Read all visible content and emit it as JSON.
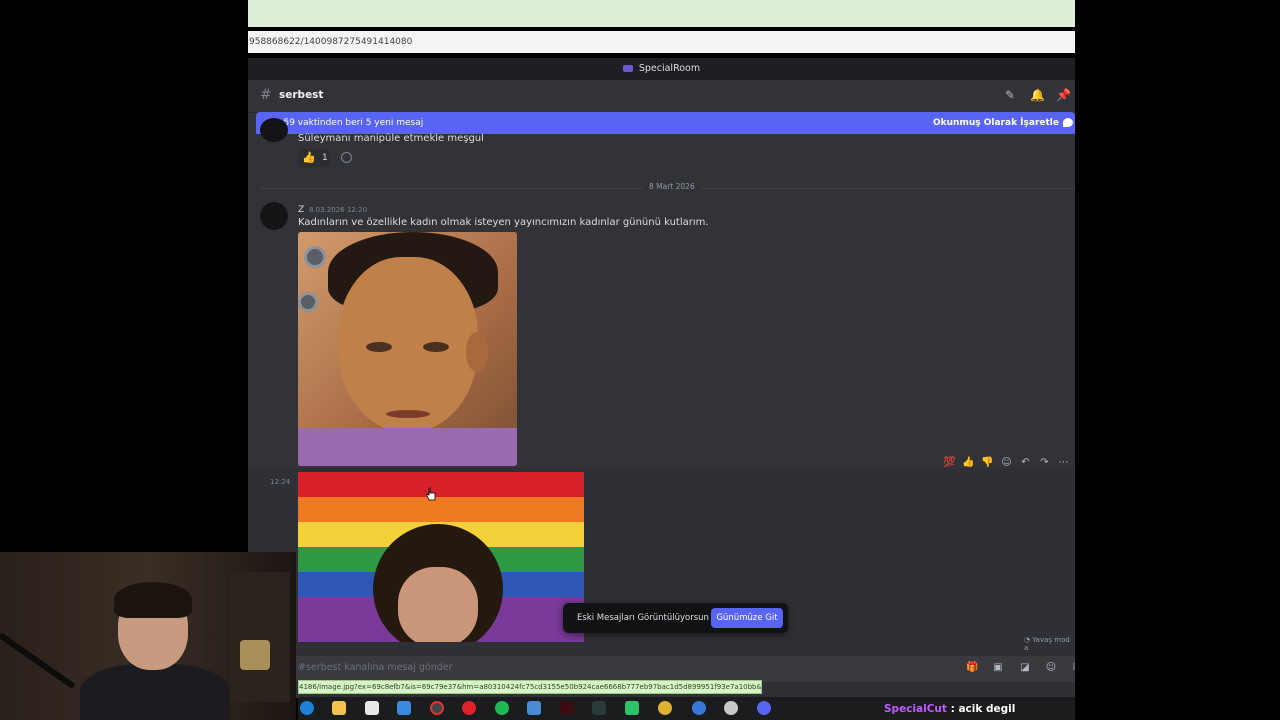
{
  "browser": {
    "url_fragment": "958868622/1400987275491414080"
  },
  "discord": {
    "server_name": "SpecialRoom",
    "channel": {
      "name": "serbest"
    },
    "new_messages_bar": {
      "left_text": "20:59 vaktinden beri 5 yeni mesaj",
      "right_text": "Okunmuş Olarak İşaretle"
    },
    "prev_message": {
      "text": "Süleymanı manipüle etmekle meşgul",
      "reaction_emoji": "👍",
      "reaction_count": "1"
    },
    "date_divider": "8 Mart 2026",
    "message": {
      "author": "Z",
      "timestamp": "8.03.2026 12:20",
      "text": "Kadınların ve özellikle kadın olmak isteyen yayıncımızın kadınlar gününü kutlarım."
    },
    "followup": {
      "timestamp": "12:24"
    },
    "jump_toast": {
      "text": "Eski Mesajları Görüntülüyorsun",
      "button": "Günümüze Git"
    },
    "slowmode_text": "Yavaş mod a",
    "composer_placeholder": "#serbest kanalına mesaj gönder"
  },
  "status_url": "4186/image.jpg?ex=69c8efb7&is=69c79e37&hm=a80310424fc75cd3155e50b924cae6668b777eb97bac1d5d899951f93e7a10bb&",
  "stream_chat": {
    "username": "SpecialCut",
    "separator": " : ",
    "message": "acik degil"
  },
  "colors": {
    "blurple": "#5865f2",
    "bg": "#313338",
    "username": "#c05cff"
  },
  "taskbar_icons": [
    "edge-icon",
    "files-icon",
    "store-icon",
    "mail-icon",
    "clock-icon",
    "opera-icon",
    "spotify-icon",
    "app-icon",
    "game-icon",
    "terminal-icon",
    "vpn-icon",
    "chrome-icon",
    "chrome-icon-2",
    "tool-icon",
    "discord-icon"
  ]
}
